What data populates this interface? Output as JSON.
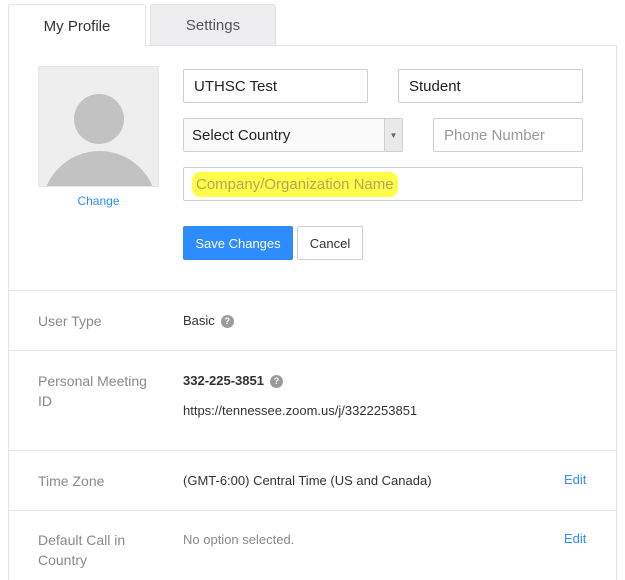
{
  "tabs": [
    {
      "label": "My Profile",
      "active": true
    },
    {
      "label": "Settings",
      "active": false
    }
  ],
  "profile": {
    "change_label": "Change",
    "first_name": "UTHSC Test",
    "last_name": "Student",
    "country": "Select Country",
    "phone_placeholder": "Phone Number",
    "company_placeholder": "Company/Organization Name",
    "save_label": "Save Changes",
    "cancel_label": "Cancel"
  },
  "info": {
    "user_type": {
      "label": "User Type",
      "value": "Basic"
    },
    "pmi": {
      "label_line1": "Personal Meeting",
      "label_line2": "ID",
      "number": "332-225-3851",
      "url": "https://tennessee.zoom.us/j/3322253851"
    },
    "time_zone": {
      "label": "Time Zone",
      "value": "(GMT-6:00) Central Time (US and Canada)",
      "edit": "Edit"
    },
    "call_in": {
      "label_line1": "Default Call in",
      "label_line2": "Country",
      "value": "No option selected.",
      "edit": "Edit"
    }
  },
  "icons": {
    "help": "?",
    "dropdown": "▼"
  },
  "colors": {
    "accent": "#2d8cff",
    "highlight": "#ffff4a"
  }
}
